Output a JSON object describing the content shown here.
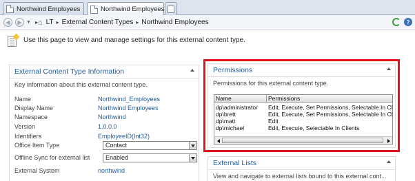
{
  "tabs": [
    {
      "label": "Northwind Employees"
    },
    {
      "label": "Northwind Employees",
      "close": "×",
      "active": true
    }
  ],
  "breadcrumb": {
    "items": [
      "LT",
      "External Content Types",
      "Northwind Employees"
    ]
  },
  "intro": {
    "text": "Use this page to view and manage settings for this external content type."
  },
  "ect_info": {
    "title": "External Content Type Information",
    "description": "Key information about this external content type.",
    "props": [
      {
        "label": "Name",
        "value": "Northwind_Employees"
      },
      {
        "label": "Display Name",
        "value": "Northwind Employees"
      },
      {
        "label": "Namespace",
        "value": "Northwind"
      },
      {
        "label": "Version",
        "value": "1.0.0.0"
      },
      {
        "label": "Identifiers",
        "value": "EmployeeID(Int32)"
      },
      {
        "label": "Office Item Type",
        "value": "Contact"
      },
      {
        "label": "Offline Sync for external list",
        "value": "Enabled"
      },
      {
        "label": "External System",
        "value": "northwind"
      }
    ]
  },
  "permissions": {
    "title": "Permissions",
    "description": "Permissions for this external content type.",
    "columns": [
      "Name",
      "Permissions"
    ],
    "rows": [
      {
        "name": "dp\\administrator",
        "permissions": "Edit, Execute, Set Permissions, Selectable In Cli"
      },
      {
        "name": "dp\\brett",
        "permissions": "Edit, Execute, Set Permissions, Selectable In Cli"
      },
      {
        "name": "dp\\matt",
        "permissions": "Edit"
      },
      {
        "name": "dp\\michael",
        "permissions": "Edit, Execute, Selectable In Clients"
      }
    ],
    "highlight_color": "#e0131d"
  },
  "external_lists": {
    "title": "External Lists",
    "description": "View and navigate to external lists bound to this external cont..."
  }
}
